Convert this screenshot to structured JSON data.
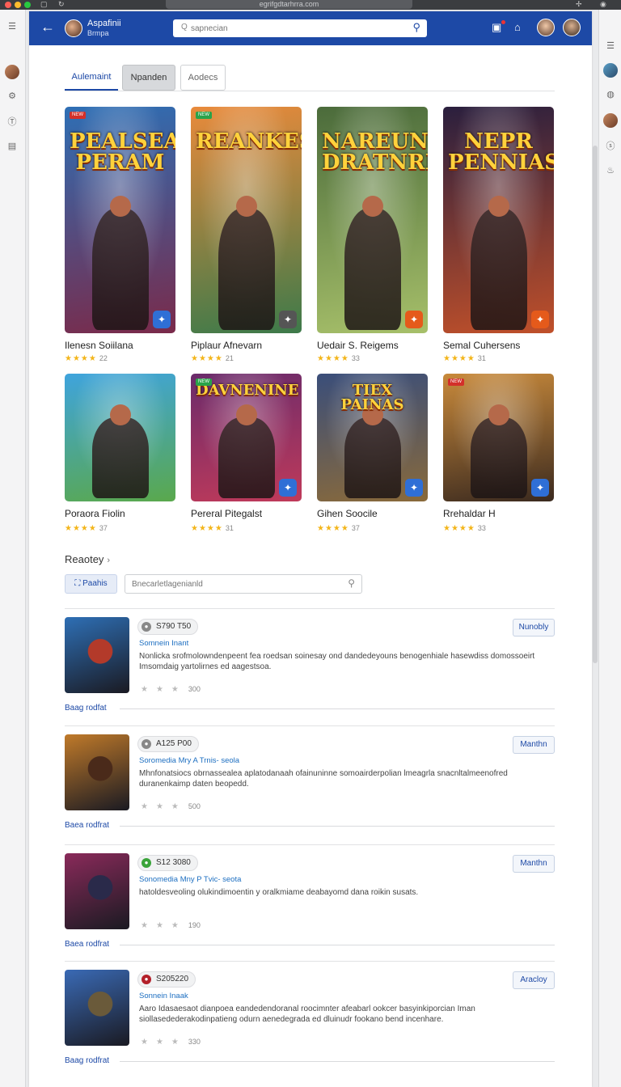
{
  "browser": {
    "url": "egrifgdtarhrra.com"
  },
  "app": {
    "name": "Aspafinii",
    "subtitle": "Brmpa"
  },
  "search": {
    "placeholder": "sapnecian"
  },
  "tabs": [
    {
      "label": "Aulemaint",
      "active": true
    },
    {
      "label": "Npanden",
      "active": false
    },
    {
      "label": "Aodecs",
      "active": false
    }
  ],
  "games": [
    {
      "name": "Ilenesn Soiilana",
      "rating_count": "22",
      "art_title": "PEALSEASN PERAM",
      "tag": "NEW",
      "colors": [
        "#2e6fb5",
        "#7a2a4a"
      ],
      "accent": "#2f6fd6"
    },
    {
      "name": "Piplaur Afnevarn",
      "rating_count": "21",
      "art_title": "REANKES",
      "tag": "NEW",
      "colors": [
        "#e98a3b",
        "#3d7a4a"
      ],
      "accent": "#555555"
    },
    {
      "name": "Uedair S. Reigems",
      "rating_count": "33",
      "art_title": "NAREUN DRATNRES",
      "tag": "",
      "colors": [
        "#4b6b3b",
        "#a7c06a"
      ],
      "accent": "#e55a1b"
    },
    {
      "name": "Semal Cuhersens",
      "rating_count": "31",
      "art_title": "NEPR PENNIAS",
      "tag": "",
      "colors": [
        "#2a1f3e",
        "#c0502a"
      ],
      "accent": "#e55a1b"
    },
    {
      "name": "Poraora Fiolin",
      "rating_count": "37",
      "art_title": "",
      "tag": "",
      "colors": [
        "#3fa4dd",
        "#5aa84c"
      ],
      "accent": ""
    },
    {
      "name": "Pereral Pitegalst",
      "rating_count": "31",
      "art_title": "DAVNENINE",
      "tag": "NEW",
      "colors": [
        "#6a2b6b",
        "#c03a5a"
      ],
      "accent": "#2f6fd6"
    },
    {
      "name": "Gihen Soocile",
      "rating_count": "37",
      "art_title": "TIEX PAINAS",
      "tag": "",
      "colors": [
        "#3a4e7a",
        "#8a6a3a"
      ],
      "accent": "#2f6fd6"
    },
    {
      "name": "Rrehaldar H",
      "rating_count": "33",
      "art_title": "",
      "tag": "NEW",
      "colors": [
        "#c98a3b",
        "#3b2a1f"
      ],
      "accent": "#2f6fd6"
    }
  ],
  "reviews_section": {
    "heading": "Reaotey",
    "filter_button": "Paahis",
    "filter_placeholder": "Bnecarletlagenianld"
  },
  "reviews": [
    {
      "price": "S790 T50",
      "subtitle": "Somnein Inant",
      "body": "Nonlicka srofmolowndenpeent fea roedsan soinesay ond dandedeyouns benogenhiale hasewdiss domossoeirt Imsomdaig yartolirnes ed aagestsoa.",
      "rating": "300",
      "action": "Nunobly",
      "footer": "Baag rodfat",
      "price_dot": "#888888",
      "thumb_colors": [
        "#2e6fb5",
        "#b33a2a"
      ]
    },
    {
      "price": "A125 P00",
      "subtitle": "Soromedia Mry A Trnis- seola",
      "body": "Mhnfonatsiocs obrnassealea aplatodanaah ofainuninne somoairderpolian lmeagrla snacnltalmeenofred duranenkaimp daten beopedd.",
      "rating": "500",
      "action": "Manthn",
      "footer": "Baea rodfrat",
      "price_dot": "#888888",
      "thumb_colors": [
        "#c07a2a",
        "#4a2a1a"
      ]
    },
    {
      "price": "S12 3080",
      "subtitle": "Sonomedia Mny P Tvic- seota",
      "body": "hatoldesveoling olukindimoentin y oralkmiame deabayomd dana roikin susats.",
      "rating": "190",
      "action": "Manthn",
      "footer": "Baea rodfrat",
      "price_dot": "#3aa43a",
      "thumb_colors": [
        "#8a2a5a",
        "#2a2a4a"
      ]
    },
    {
      "price": "S205220",
      "subtitle": "Sonnein Inaak",
      "body": "Aaro Idasaesaot dianpoea eandedendoranal roocimnter afeabarl ookcer basyinkiporcian Iman siollasedederakodinpatieng odurn aenedegrada ed dluinudr fookano bend incenhare.",
      "rating": "330",
      "action": "Aracloy",
      "footer": "Baag rodfrat",
      "price_dot": "#b3202a",
      "thumb_colors": [
        "#3a6ab5",
        "#6a5a3a"
      ]
    }
  ],
  "icons": {
    "back": "back-arrow-icon",
    "search": "search-icon",
    "notifications": "notification-icon",
    "home": "home-icon"
  }
}
